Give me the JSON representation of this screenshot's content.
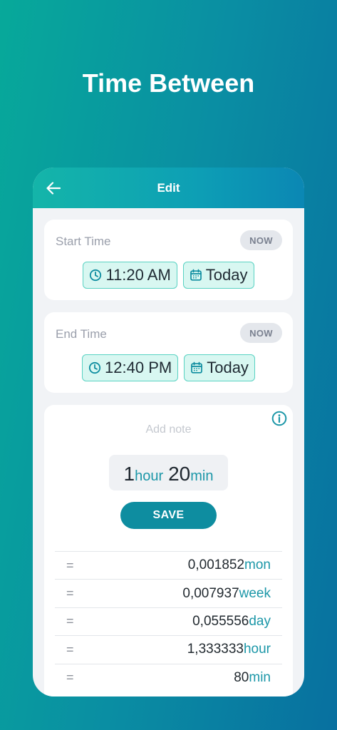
{
  "hero": {
    "title": "Time Between"
  },
  "appbar": {
    "title": "Edit"
  },
  "start": {
    "label": "Start Time",
    "now_label": "NOW",
    "time": "11:20 AM",
    "date": "Today"
  },
  "end": {
    "label": "End Time",
    "now_label": "NOW",
    "time": "12:40 PM",
    "date": "Today"
  },
  "result": {
    "note_placeholder": "Add note",
    "hours_value": "1",
    "hours_unit": "hour",
    "minutes_value": "20",
    "minutes_unit": "min",
    "save_label": "SAVE",
    "rows": [
      {
        "eq": "=",
        "value": "0,001852",
        "unit": "mon"
      },
      {
        "eq": "=",
        "value": "0,007937",
        "unit": "week"
      },
      {
        "eq": "=",
        "value": "0,055556",
        "unit": "day"
      },
      {
        "eq": "=",
        "value": "1,333333",
        "unit": "hour"
      },
      {
        "eq": "=",
        "value": "80",
        "unit": "min"
      }
    ]
  },
  "colors": {
    "accent": "#0e8da0",
    "chip_bg": "#d8f7f1",
    "chip_border": "#58d2c2"
  },
  "icons": {
    "back": "arrow-left-icon",
    "clock": "clock-icon",
    "calendar": "calendar-icon",
    "info": "info-icon"
  }
}
